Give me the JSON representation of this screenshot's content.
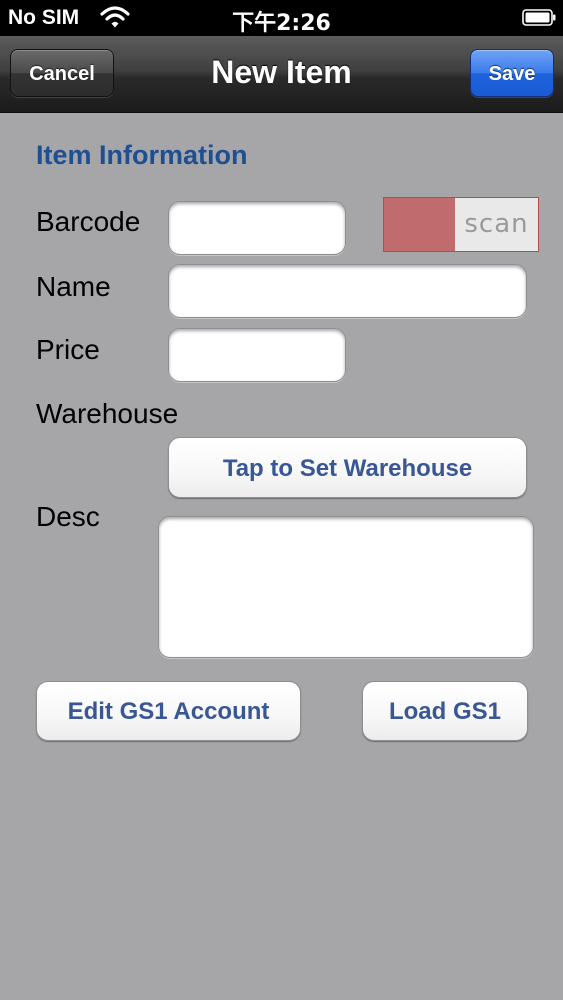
{
  "status_bar": {
    "carrier": "No SIM",
    "time": "下午2:26",
    "wifi_icon": "wifi-icon",
    "battery_icon": "battery-icon"
  },
  "nav": {
    "title": "New Item",
    "cancel_label": "Cancel",
    "save_label": "Save"
  },
  "form": {
    "section_title": "Item Information",
    "barcode": {
      "label": "Barcode",
      "value": "",
      "placeholder": ""
    },
    "scan_toggle": {
      "label": "scan",
      "state": "off"
    },
    "name": {
      "label": "Name",
      "value": "",
      "placeholder": ""
    },
    "price": {
      "label": "Price",
      "value": "",
      "placeholder": ""
    },
    "warehouse": {
      "label": "Warehouse",
      "button_label": "Tap to Set Warehouse"
    },
    "desc": {
      "label": "Desc",
      "value": ""
    }
  },
  "actions": {
    "edit_gs1_label": "Edit GS1 Account",
    "load_gs1_label": "Load GS1"
  },
  "colors": {
    "background": "#a6a6a9",
    "section_title": "#1d4f91",
    "button_text": "#3a5795",
    "save_blue": "#1f63dc",
    "scan_knob": "#c06b6e"
  }
}
